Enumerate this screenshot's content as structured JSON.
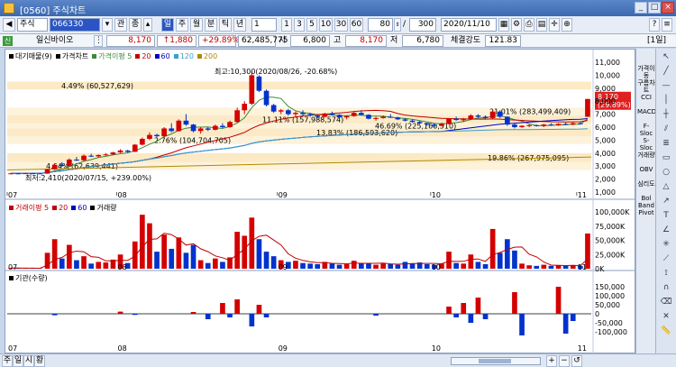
{
  "window": {
    "title": "[0560] 주식차트"
  },
  "toolbar": {
    "market": "주식",
    "code": "066330",
    "buttons": [
      "관",
      "종"
    ],
    "periods": [
      "주",
      "월",
      "분",
      "틱",
      "년"
    ],
    "interval_value": "1",
    "intervals": [
      "1",
      "3",
      "5",
      "10",
      "30",
      "60"
    ],
    "display_count": "80",
    "total_count": "300",
    "date": "2020/11/10"
  },
  "quote": {
    "name": "일신바이오",
    "price": "8,170",
    "change": "↑1,880",
    "change_pct": "+29.89%",
    "volume": "62,485,775",
    "open_label": "시",
    "open": "6,800",
    "high_label": "고",
    "high": "8,170",
    "low_label": "저",
    "low": "6,780",
    "strength_label": "체결강도",
    "strength": "121.83",
    "period": "[1일]"
  },
  "price_panel": {
    "legend": [
      {
        "text": "대기매물(9)",
        "color": "#000000"
      },
      {
        "text": "가격차트",
        "color": "#000000"
      },
      {
        "text": "가격이평 5",
        "color": "#3a8a3a"
      },
      {
        "text": "20",
        "color": "#c00000"
      },
      {
        "text": "60",
        "color": "#0000c0"
      },
      {
        "text": "120",
        "color": "#3aa0c8"
      },
      {
        "text": "200",
        "color": "#b08a00"
      }
    ],
    "annotations": {
      "high_note": "최고:10,300(2020/08/26, -20.68%)",
      "low_note": "최저:2,410(2020/07/15, +239.00%)",
      "current_price_tag": "8,170",
      "current_pct_tag": "(29.89%)"
    },
    "y_ticks": [
      "11,000",
      "10,000",
      "9,000",
      "8,000",
      "7,000",
      "6,000",
      "5,000",
      "4,000",
      "3,000",
      "2,000",
      "1,000"
    ]
  },
  "volume_panel": {
    "legend": [
      {
        "text": "거래이평 5",
        "color": "#c00000"
      },
      {
        "text": "20",
        "color": "#c00000"
      },
      {
        "text": "60",
        "color": "#0000c0"
      },
      {
        "text": "거래량",
        "color": "#000000"
      }
    ],
    "y_ticks": [
      "100,000K",
      "75,000K",
      "50,000K",
      "25,000K",
      "0K"
    ]
  },
  "inst_panel": {
    "legend": [
      {
        "text": "기관(수량)",
        "color": "#000000"
      }
    ],
    "y_ticks": [
      "150,000",
      "100,000",
      "50,000",
      "0",
      "-50,000",
      "-100,000"
    ]
  },
  "x_labels": [
    "07",
    "08",
    "09",
    "10",
    "11"
  ],
  "right_indicators": [
    "가격이동",
    "구름차트",
    "CCI",
    "MACD",
    "F-Sloc",
    "S-Sloc",
    "거래량",
    "OBV",
    "심리도",
    "Bol Band",
    "Pivot"
  ],
  "status_tabs": [
    "주",
    "일",
    "시",
    "황"
  ],
  "chart_data": {
    "type": "candlestick",
    "price_range": [
      1000,
      11000
    ],
    "supply_zones": [
      {
        "label": "4.49% (60,527,629)",
        "low": 8900,
        "high": 9500
      },
      {
        "label": "21.01% (283,499,409)",
        "low": 6900,
        "high": 7500
      },
      {
        "label": "11.11% (157,988,574)",
        "low": 6300,
        "high": 6900
      },
      {
        "label": "46.69% (225,166,510)",
        "low": 5900,
        "high": 6300
      },
      {
        "label": "13.83% (186,593,620)",
        "low": 5300,
        "high": 5900
      },
      {
        "label": "2.76% (104,704,705)",
        "low": 4700,
        "high": 5300
      },
      {
        "label": "19.86% (267,975,095)",
        "low": 3300,
        "high": 4000
      },
      {
        "label": "4.64% (62,639,441)",
        "low": 2700,
        "high": 3300
      }
    ],
    "candles": [
      [
        2420,
        2480,
        2400,
        2440
      ],
      [
        2440,
        2460,
        2410,
        2430
      ],
      [
        2430,
        2470,
        2410,
        2450
      ],
      [
        2450,
        2480,
        2420,
        2440
      ],
      [
        2440,
        2460,
        2410,
        2420
      ],
      [
        2420,
        2800,
        2410,
        2760
      ],
      [
        2760,
        3200,
        2700,
        3100
      ],
      [
        3100,
        3300,
        2950,
        3000
      ],
      [
        3000,
        3600,
        2980,
        3500
      ],
      [
        3500,
        3700,
        3400,
        3450
      ],
      [
        3450,
        3900,
        3400,
        3800
      ],
      [
        3800,
        3950,
        3700,
        3750
      ],
      [
        3750,
        3900,
        3650,
        3850
      ],
      [
        3850,
        4000,
        3800,
        3900
      ],
      [
        3900,
        4100,
        3850,
        4050
      ],
      [
        4050,
        4300,
        4000,
        4200
      ],
      [
        4200,
        4250,
        4050,
        4100
      ],
      [
        4100,
        4700,
        4080,
        4650
      ],
      [
        4650,
        5200,
        4600,
        5100
      ],
      [
        5100,
        5600,
        5000,
        5400
      ],
      [
        5400,
        5500,
        5200,
        5300
      ],
      [
        5300,
        6000,
        5250,
        5900
      ],
      [
        5900,
        6300,
        5600,
        5700
      ],
      [
        5700,
        6600,
        5650,
        6500
      ],
      [
        6500,
        7000,
        6100,
        6200
      ],
      [
        6200,
        6250,
        5600,
        5700
      ],
      [
        5700,
        6000,
        5500,
        5900
      ],
      [
        5900,
        6000,
        5700,
        5800
      ],
      [
        5800,
        6200,
        5750,
        6100
      ],
      [
        6100,
        6300,
        5900,
        6000
      ],
      [
        6000,
        6500,
        5950,
        6400
      ],
      [
        6400,
        7500,
        6350,
        7300
      ],
      [
        7300,
        8000,
        7000,
        7800
      ],
      [
        7800,
        10300,
        7700,
        10000
      ],
      [
        9900,
        10000,
        8700,
        8800
      ],
      [
        8800,
        8900,
        7600,
        7700
      ],
      [
        7700,
        7800,
        7100,
        7200
      ],
      [
        7200,
        7400,
        7000,
        7300
      ],
      [
        7300,
        7400,
        6900,
        7000
      ],
      [
        7000,
        7200,
        6800,
        7100
      ],
      [
        7100,
        7300,
        6900,
        7000
      ],
      [
        7000,
        7100,
        6800,
        6900
      ],
      [
        6900,
        7000,
        6700,
        6800
      ],
      [
        6800,
        7100,
        6750,
        7050
      ],
      [
        7050,
        7200,
        6900,
        6950
      ],
      [
        6950,
        7000,
        6700,
        6750
      ],
      [
        6750,
        6900,
        6600,
        6850
      ],
      [
        6850,
        7200,
        6800,
        7100
      ],
      [
        7100,
        7300,
        6900,
        6950
      ],
      [
        6950,
        7000,
        6600,
        6650
      ],
      [
        6650,
        6800,
        6500,
        6700
      ],
      [
        6700,
        6900,
        6650,
        6800
      ],
      [
        6800,
        7000,
        6700,
        6750
      ],
      [
        6750,
        6800,
        6550,
        6600
      ],
      [
        6600,
        6700,
        6450,
        6500
      ],
      [
        6500,
        6600,
        6350,
        6400
      ],
      [
        6400,
        6500,
        6200,
        6300
      ],
      [
        6300,
        6350,
        6100,
        6200
      ],
      [
        6200,
        6300,
        6000,
        6100
      ],
      [
        6100,
        6300,
        6050,
        6250
      ],
      [
        6250,
        6700,
        6200,
        6650
      ],
      [
        6650,
        6800,
        6500,
        6550
      ],
      [
        6550,
        6700,
        6400,
        6600
      ],
      [
        6600,
        7000,
        6550,
        6900
      ],
      [
        6900,
        7000,
        6700,
        6800
      ],
      [
        6800,
        6900,
        6600,
        6700
      ],
      [
        6700,
        7300,
        6650,
        7200
      ],
      [
        7200,
        7300,
        6700,
        6800
      ],
      [
        6800,
        6850,
        6100,
        6200
      ],
      [
        6200,
        6300,
        5900,
        6000
      ],
      [
        6000,
        6150,
        5950,
        6100
      ],
      [
        6100,
        6200,
        6000,
        6150
      ],
      [
        6150,
        6200,
        6050,
        6100
      ],
      [
        6100,
        6250,
        6000,
        6200
      ],
      [
        6200,
        6300,
        6100,
        6150
      ],
      [
        6150,
        6300,
        6100,
        6250
      ],
      [
        6250,
        6350,
        6150,
        6200
      ],
      [
        6200,
        6400,
        6150,
        6300
      ],
      [
        6300,
        6400,
        6200,
        6290
      ],
      [
        6800,
        8170,
        6780,
        8170
      ]
    ],
    "volume": [
      1200,
      900,
      800,
      700,
      600,
      28000,
      52000,
      18000,
      42000,
      15000,
      22000,
      9000,
      12000,
      11000,
      16000,
      25000,
      10000,
      48000,
      95000,
      80000,
      30000,
      60000,
      35000,
      55000,
      28000,
      42000,
      15000,
      10000,
      18000,
      12000,
      20000,
      65000,
      58000,
      90000,
      52000,
      30000,
      22000,
      15000,
      12000,
      14000,
      10000,
      9000,
      8000,
      12000,
      9000,
      7000,
      8000,
      14000,
      10000,
      9000,
      7000,
      9000,
      8000,
      7000,
      12000,
      9000,
      11000,
      8000,
      7000,
      9000,
      30000,
      10000,
      9000,
      25000,
      12000,
      8000,
      70000,
      28000,
      52000,
      32000,
      9000,
      6000,
      5000,
      7000,
      5000,
      6000,
      5000,
      6000,
      5000,
      62000
    ],
    "institution": [
      0,
      0,
      0,
      0,
      0,
      0,
      -8000,
      0,
      0,
      0,
      0,
      0,
      0,
      0,
      0,
      12000,
      0,
      -6000,
      0,
      0,
      0,
      0,
      0,
      0,
      0,
      10000,
      0,
      -30000,
      0,
      60000,
      -20000,
      80000,
      0,
      -70000,
      50000,
      -20000,
      0,
      0,
      0,
      0,
      0,
      0,
      0,
      0,
      0,
      0,
      0,
      0,
      0,
      0,
      -10000,
      0,
      0,
      0,
      0,
      0,
      0,
      0,
      0,
      0,
      40000,
      -20000,
      60000,
      -50000,
      90000,
      -30000,
      0,
      0,
      0,
      120000,
      -120000,
      0,
      0,
      0,
      0,
      150000,
      -110000,
      -40000,
      0,
      0
    ]
  }
}
